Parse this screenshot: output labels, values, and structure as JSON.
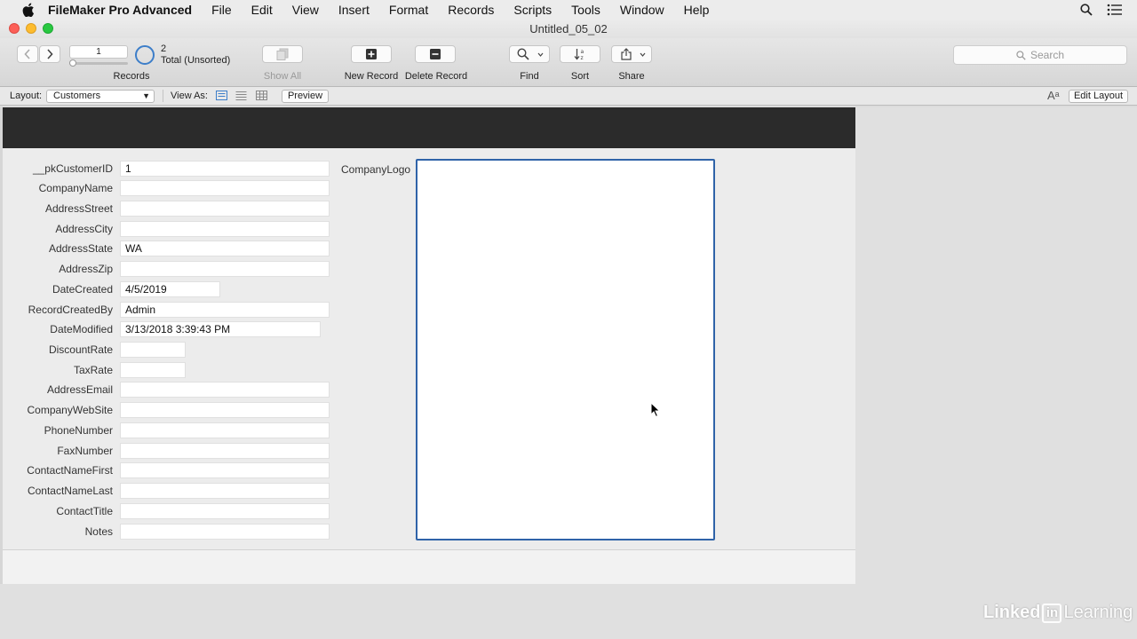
{
  "menubar": {
    "app_name": "FileMaker Pro Advanced",
    "items": [
      "File",
      "Edit",
      "View",
      "Insert",
      "Format",
      "Records",
      "Scripts",
      "Tools",
      "Window",
      "Help"
    ]
  },
  "window": {
    "title": "Untitled_05_02"
  },
  "toolbar": {
    "record_number": "1",
    "records_label": "Records",
    "found_count": "2",
    "found_status": "Total (Unsorted)",
    "show_all_label": "Show All",
    "new_record_label": "New Record",
    "delete_record_label": "Delete Record",
    "find_label": "Find",
    "sort_label": "Sort",
    "share_label": "Share",
    "search_placeholder": "Search"
  },
  "layoutbar": {
    "layout_label": "Layout:",
    "layout_value": "Customers",
    "view_as_label": "View As:",
    "preview_label": "Preview",
    "edit_layout_label": "Edit Layout"
  },
  "fields": [
    {
      "label": "__pkCustomerID",
      "value": "1"
    },
    {
      "label": "CompanyName",
      "value": ""
    },
    {
      "label": "AddressStreet",
      "value": ""
    },
    {
      "label": "AddressCity",
      "value": ""
    },
    {
      "label": "AddressState",
      "value": "WA"
    },
    {
      "label": "AddressZip",
      "value": ""
    },
    {
      "label": "DateCreated",
      "value": "4/5/2019"
    },
    {
      "label": "RecordCreatedBy",
      "value": "Admin"
    },
    {
      "label": "DateModified",
      "value": "3/13/2018 3:39:43 PM"
    },
    {
      "label": "DiscountRate",
      "value": ""
    },
    {
      "label": "TaxRate",
      "value": ""
    },
    {
      "label": "AddressEmail",
      "value": ""
    },
    {
      "label": "CompanyWebSite",
      "value": ""
    },
    {
      "label": "PhoneNumber",
      "value": ""
    },
    {
      "label": "FaxNumber",
      "value": ""
    },
    {
      "label": "ContactNameFirst",
      "value": ""
    },
    {
      "label": "ContactNameLast",
      "value": ""
    },
    {
      "label": "ContactTitle",
      "value": ""
    },
    {
      "label": "Notes",
      "value": ""
    }
  ],
  "logo": {
    "label": "CompanyLogo"
  },
  "watermark": {
    "linked": "Linked",
    "in": "in",
    "learning": "Learning"
  },
  "colors": {
    "accent": "#2f63a8",
    "header_band": "#2b2b2b"
  }
}
